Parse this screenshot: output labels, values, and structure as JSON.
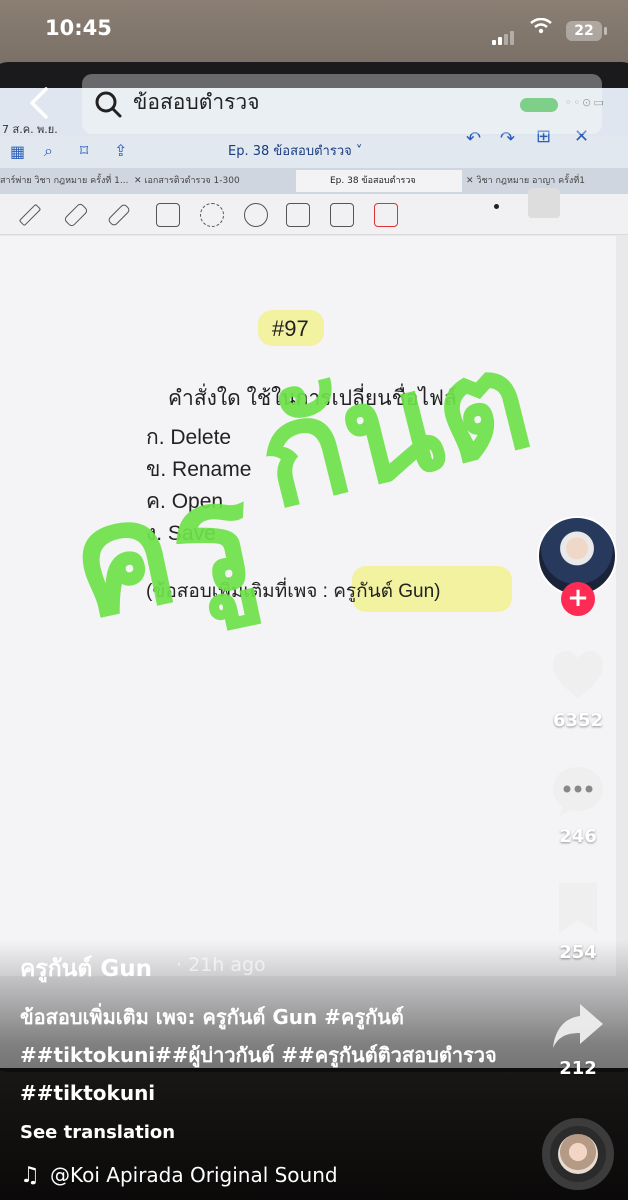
{
  "status_bar": {
    "time": "10:45",
    "battery": "22"
  },
  "search": {
    "query": "ข้อสอบตำรวจ"
  },
  "tablet": {
    "date": "7 ส.ค. พ.ย.",
    "episode_title": "Ep. 38 ข้อสอบตำรวจ ˅",
    "tabs": [
      "สาร์พ่าย วิชา กฎหมาย ครั้งที่ 1...",
      "✕  เอกสารติวตำรวจ 1-300",
      "Ep. 38 ข้อสอบตำรวจ",
      "✕  วิชา กฎหมาย อาญา ครั้งที่1"
    ]
  },
  "document": {
    "question_number": "#97",
    "question": "คำสั่งใด ใช้ในการเปลี่ยนชื่อไฟล์",
    "options": [
      "ก. Delete",
      "ข. Rename",
      "ค. Open",
      "ง. Save"
    ],
    "more_info": "(ข้อสอบเพิ่มเติมที่เพจ : ครูกันต์ Gun)"
  },
  "watermark": {
    "line1": "ครู",
    "line2": "กันต"
  },
  "actions": {
    "likes": "6352",
    "comments": "246",
    "saves": "254",
    "shares": "212"
  },
  "video": {
    "author": "ครูกันต์ Gun",
    "time_ago": "· 21h ago",
    "caption": "ข้อสอบเพิ่มเติม เพจ: ครูกันต์ Gun #ครูกันต์ ##tiktokuni##ผู้บ่าวกันต์ ##ครูกันต์ติวสอบตำรวจ ##tiktokuni",
    "see_translation": "See translation",
    "sound": "@Koi Apirada Original Sound"
  },
  "colors": {
    "accent_like": "#fe2c55",
    "watermark_green": "#6fe24a",
    "highlight_yellow": "#f0f05a"
  }
}
